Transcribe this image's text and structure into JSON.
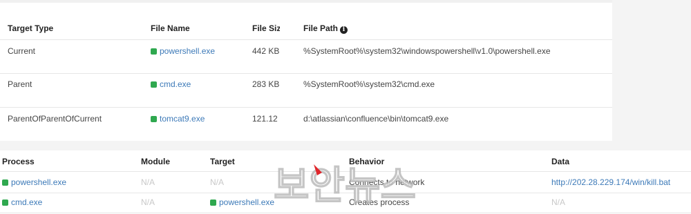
{
  "file_table": {
    "headers": {
      "target_type": "Target Type",
      "file_name": "File Name",
      "file_size": "File Size",
      "file_path": "File Path"
    },
    "rows": [
      {
        "target_type": "Current",
        "file_name": "powershell.exe",
        "file_size": "442 KB",
        "file_path": "%SystemRoot%\\system32\\windowspowershell\\v1.0\\powershell.exe"
      },
      {
        "target_type": "Parent",
        "file_name": "cmd.exe",
        "file_size": "283 KB",
        "file_path": "%SystemRoot%\\system32\\cmd.exe"
      },
      {
        "target_type": "ParentOfParentOfCurrent",
        "file_name": "tomcat9.exe",
        "file_size": "121.12",
        "file_path": "d:\\atlassian\\confluence\\bin\\tomcat9.exe"
      }
    ]
  },
  "behavior_table": {
    "headers": {
      "process": "Process",
      "module": "Module",
      "target": "Target",
      "behavior": "Behavior",
      "data": "Data"
    },
    "rows": [
      {
        "process": "powershell.exe",
        "module": "N/A",
        "target": "N/A",
        "behavior": "Connects to network",
        "data": "http://202.28.229.174/win/kill.bat"
      },
      {
        "process": "cmd.exe",
        "module": "N/A",
        "target": "powershell.exe",
        "behavior": "Creates process",
        "data": "N/A"
      }
    ]
  },
  "watermark": {
    "text": "보안뉴스"
  },
  "colors": {
    "link": "#3d7ab8",
    "file_icon": "#2fa84f",
    "na_text": "#c8c8c8",
    "band": "#f4f4f4"
  },
  "icons": {
    "file": "green-square-icon",
    "info": "info-icon"
  }
}
